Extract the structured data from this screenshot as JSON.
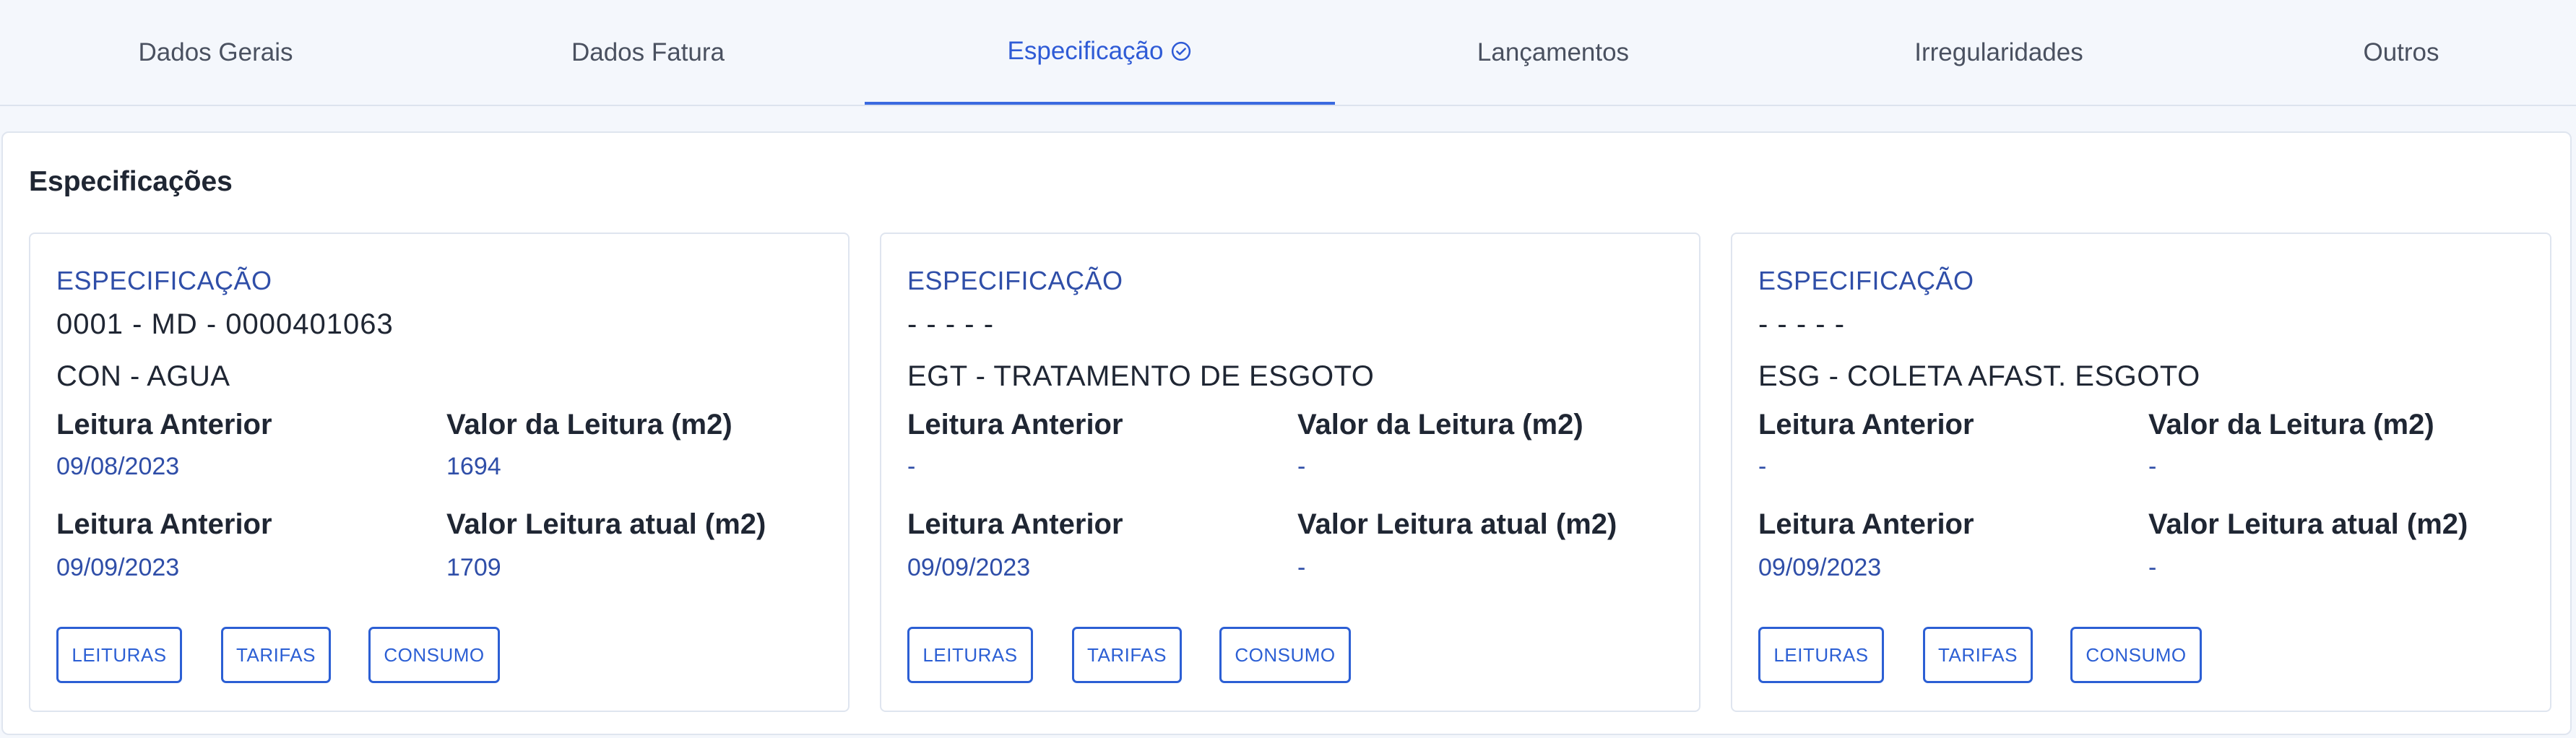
{
  "tabs": [
    {
      "label": "Dados Gerais"
    },
    {
      "label": "Dados Fatura"
    },
    {
      "label": "Especificação",
      "active": true
    },
    {
      "label": "Lançamentos"
    },
    {
      "label": "Irregularidades"
    },
    {
      "label": "Outros"
    }
  ],
  "panel": {
    "title": "Especificações"
  },
  "cards": [
    {
      "spec_label": "ESPECIFICAÇÃO",
      "code": "0001 - MD - 0000401063",
      "name": "CON - AGUA",
      "fields": [
        {
          "label": "Leitura Anterior",
          "value": "09/08/2023"
        },
        {
          "label": "Valor da Leitura (m2)",
          "value": "1694"
        },
        {
          "label": "Leitura Anterior",
          "value": "09/09/2023"
        },
        {
          "label": "Valor Leitura atual (m2)",
          "value": "1709"
        }
      ],
      "buttons": [
        "LEITURAS",
        "TARIFAS",
        "CONSUMO"
      ]
    },
    {
      "spec_label": "ESPECIFICAÇÃO",
      "code": "- - - - -",
      "name": "EGT - TRATAMENTO DE ESGOTO",
      "fields": [
        {
          "label": "Leitura Anterior",
          "value": "-"
        },
        {
          "label": "Valor da Leitura (m2)",
          "value": "-"
        },
        {
          "label": "Leitura Anterior",
          "value": "09/09/2023"
        },
        {
          "label": "Valor Leitura atual (m2)",
          "value": "-"
        }
      ],
      "buttons": [
        "LEITURAS",
        "TARIFAS",
        "CONSUMO"
      ]
    },
    {
      "spec_label": "ESPECIFICAÇÃO",
      "code": "- - - - -",
      "name": "ESG - COLETA AFAST. ESGOTO",
      "fields": [
        {
          "label": "Leitura Anterior",
          "value": "-"
        },
        {
          "label": "Valor da Leitura (m2)",
          "value": "-"
        },
        {
          "label": "Leitura Anterior",
          "value": "09/09/2023"
        },
        {
          "label": "Valor Leitura atual (m2)",
          "value": "-"
        }
      ],
      "buttons": [
        "LEITURAS",
        "TARIFAS",
        "CONSUMO"
      ]
    }
  ],
  "colors": {
    "accent": "#2c5fd4",
    "value_text": "#2f4ea8",
    "border": "#dfe5ef",
    "background": "#f4f7fc"
  },
  "icons": {
    "active_tab": "check-circle-icon"
  }
}
